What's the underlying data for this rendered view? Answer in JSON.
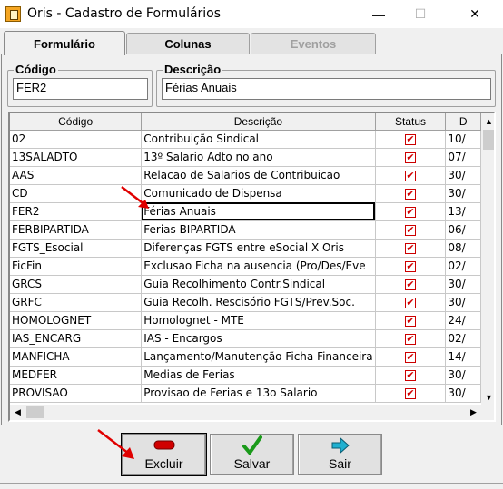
{
  "window": {
    "title": "Oris - Cadastro de Formulários",
    "minimize": "—",
    "maximize": "☐",
    "close": "✕"
  },
  "tabs": [
    {
      "label": "Formulário",
      "state": "active"
    },
    {
      "label": "Colunas",
      "state": "normal"
    },
    {
      "label": "Eventos",
      "state": "disabled"
    }
  ],
  "form": {
    "codigo_label": "Código",
    "codigo_value": "FER2",
    "descricao_label": "Descrição",
    "descricao_value": "Férias Anuais"
  },
  "grid": {
    "columns": [
      "Código",
      "Descrição",
      "Status",
      "D"
    ],
    "rows": [
      {
        "codigo": "02",
        "descricao": "Contribuição Sindical",
        "status": true,
        "d": "10/"
      },
      {
        "codigo": "13SALADTO",
        "descricao": "13º Salario Adto no ano",
        "status": true,
        "d": "07/"
      },
      {
        "codigo": "AAS",
        "descricao": "Relacao de Salarios de Contribuicao",
        "status": true,
        "d": "30/"
      },
      {
        "codigo": "CD",
        "descricao": "Comunicado de Dispensa",
        "status": true,
        "d": "30/"
      },
      {
        "codigo": "FER2",
        "descricao": "Férias Anuais",
        "status": true,
        "d": "13/"
      },
      {
        "codigo": "FERBIPARTIDA",
        "descricao": "Ferias BIPARTIDA",
        "status": true,
        "d": "06/"
      },
      {
        "codigo": "FGTS_Esocial",
        "descricao": "Diferenças FGTS entre eSocial X Oris",
        "status": true,
        "d": "08/"
      },
      {
        "codigo": "FicFin",
        "descricao": "Exclusao Ficha na ausencia (Pro/Des/Eve",
        "status": true,
        "d": "02/"
      },
      {
        "codigo": "GRCS",
        "descricao": "Guia Recolhimento Contr.Sindical",
        "status": true,
        "d": "30/"
      },
      {
        "codigo": "GRFC",
        "descricao": "Guia Recolh. Rescisório FGTS/Prev.Soc.",
        "status": true,
        "d": "30/"
      },
      {
        "codigo": "HOMOLOGNET",
        "descricao": "Homolognet - MTE",
        "status": true,
        "d": "24/"
      },
      {
        "codigo": "IAS_ENCARG",
        "descricao": "IAS - Encargos",
        "status": true,
        "d": "02/"
      },
      {
        "codigo": "MANFICHA",
        "descricao": "Lançamento/Manutenção Ficha Financeira",
        "status": true,
        "d": "14/"
      },
      {
        "codigo": "MEDFER",
        "descricao": "Medias de Ferias",
        "status": true,
        "d": "30/"
      },
      {
        "codigo": "PROVISAO",
        "descricao": "Provisao de Ferias e 13o Salario",
        "status": true,
        "d": "30/"
      }
    ],
    "selected_row": "FER2"
  },
  "buttons": {
    "excluir": "Excluir",
    "salvar": "Salvar",
    "sair": "Sair"
  },
  "icons": {
    "excluir": "minus-icon",
    "salvar": "checkmark-icon",
    "sair": "exit-arrow-icon"
  },
  "colors": {
    "check_red": "#d00000",
    "annotation_red": "#e00000",
    "save_green": "#1a9a1a",
    "exit_cyan": "#20b0d0"
  }
}
